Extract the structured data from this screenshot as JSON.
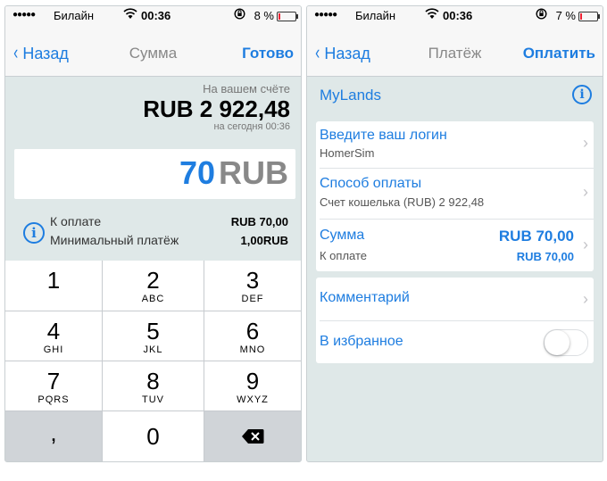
{
  "left": {
    "status": {
      "dots": "●●●●●",
      "carrier": "Билайн",
      "time": "00:36",
      "battery": "8 %"
    },
    "nav": {
      "back": "Назад",
      "title": "Сумма",
      "action": "Готово"
    },
    "balance": {
      "caption": "На вашем счёте",
      "value": "RUB 2 922,48",
      "date": "на сегодня 00:36"
    },
    "amount": {
      "number": "70",
      "currency": "RUB"
    },
    "summary": [
      {
        "label": "К оплате",
        "value": "RUB 70,00"
      },
      {
        "label": "Минимальный платёж",
        "value": "1,00RUB"
      }
    ],
    "keys": [
      {
        "digit": "1",
        "letters": ""
      },
      {
        "digit": "2",
        "letters": "ABC"
      },
      {
        "digit": "3",
        "letters": "DEF"
      },
      {
        "digit": "4",
        "letters": "GHI"
      },
      {
        "digit": "5",
        "letters": "JKL"
      },
      {
        "digit": "6",
        "letters": "MNO"
      },
      {
        "digit": "7",
        "letters": "PQRS"
      },
      {
        "digit": "8",
        "letters": "TUV"
      },
      {
        "digit": "9",
        "letters": "WXYZ"
      },
      {
        "digit": ",",
        "letters": ""
      },
      {
        "digit": "0",
        "letters": ""
      }
    ]
  },
  "right": {
    "status": {
      "dots": "●●●●●",
      "carrier": "Билайн",
      "time": "00:36",
      "battery": "7 %"
    },
    "nav": {
      "back": "Назад",
      "title": "Платёж",
      "action": "Оплатить"
    },
    "merchant": "MyLands",
    "login": {
      "title": "Введите ваш логин",
      "value": "HomerSim"
    },
    "method": {
      "title": "Способ оплаты",
      "value": "Счет кошелька (RUB) 2 922,48"
    },
    "sum": {
      "title": "Сумма",
      "amount": "RUB 70,00",
      "sub_label": "К оплате",
      "sub_value": "RUB 70,00"
    },
    "comment": "Комментарий",
    "favorite": {
      "label": "В избранное",
      "on": false
    }
  },
  "icons": {
    "info": "i",
    "chevron": "›",
    "back": "‹",
    "wifi": "wifi-icon",
    "lock": "rotation-lock-icon"
  },
  "colors": {
    "accent": "#1e7de0",
    "background": "#dfe8e8"
  }
}
